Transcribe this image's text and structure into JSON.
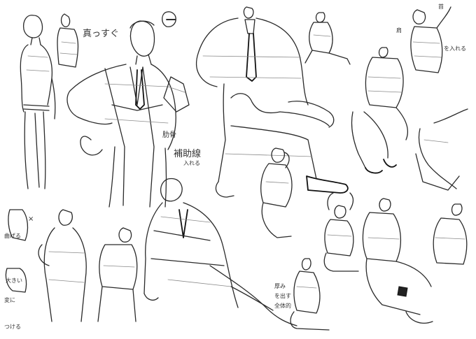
{
  "notes": {
    "straight": "真っすぐ",
    "ribcage": "肋骨",
    "aux": "補助線",
    "insert": "入れる",
    "shoulder": "肩",
    "nape": "首",
    "tuck": "を入れる",
    "bend": "曲げる",
    "alter": "変に",
    "tighten": "つける",
    "bigger": "大きい",
    "thick": "厚み",
    "emphasize": "を出す",
    "vary": "全体的",
    "note_x": "×"
  }
}
